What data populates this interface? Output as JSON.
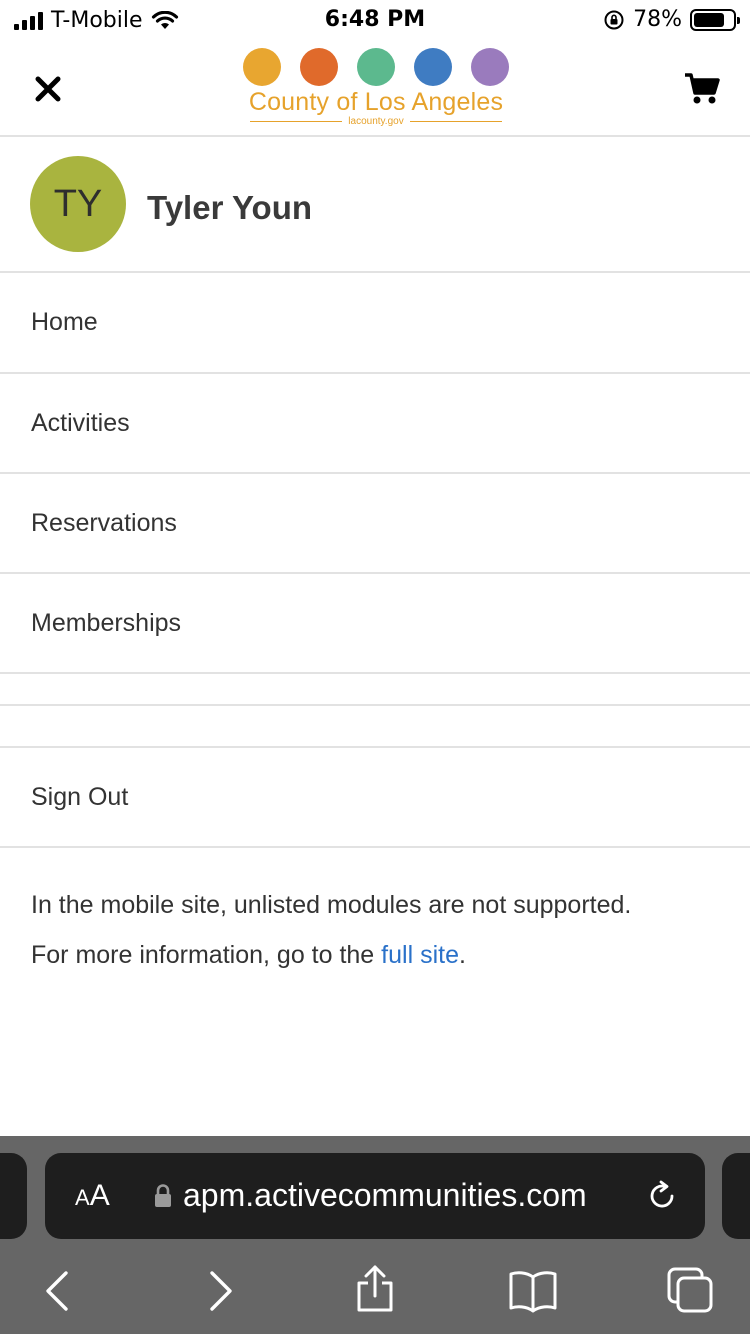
{
  "status_bar": {
    "carrier": "T-Mobile",
    "time": "6:48 PM",
    "battery_percent": "78%",
    "battery_level": 0.78,
    "icons": [
      "signal-icon",
      "wifi-icon",
      "orientation-lock-icon",
      "battery-icon"
    ]
  },
  "header": {
    "logo_name": "County of Los Angeles",
    "logo_sub": "lacounty.gov",
    "logo_colors": [
      "#e8a630",
      "#e06a2b",
      "#5cb98e",
      "#3f7cc2",
      "#9a7bbd"
    ],
    "icons": [
      "close-icon",
      "cart-icon"
    ]
  },
  "profile": {
    "initials": "TY",
    "name": "Tyler Youn",
    "avatar_color": "#a9b43f"
  },
  "menu": {
    "items": [
      "Home",
      "Activities",
      "Reservations",
      "Memberships"
    ],
    "sign_out": "Sign Out"
  },
  "note": {
    "line1": "In the mobile site, unlisted modules are not supported.",
    "line2_prefix": "For more information, go to the ",
    "link": "full site",
    "line2_suffix": "."
  },
  "safari": {
    "aa_small": "A",
    "aa_large": "A",
    "url": "apm.activecommunities.com",
    "icons": [
      "lock-icon",
      "reload-icon",
      "back-icon",
      "forward-icon",
      "share-icon",
      "bookmarks-icon",
      "tabs-icon"
    ]
  },
  "colors": {
    "link": "#2a71c9",
    "divider": "#e2e2e2",
    "logo_text": "#e6a22b"
  }
}
